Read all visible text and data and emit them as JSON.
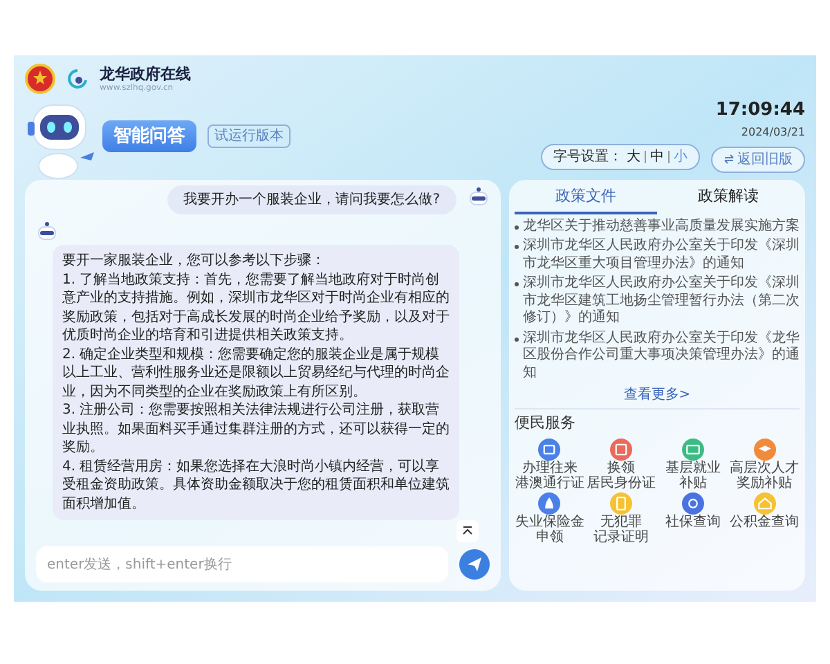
{
  "header": {
    "site_name": "龙华政府在线",
    "site_url": "www.szlhq.gov.cn",
    "badge": "智能问答",
    "tag": "试运行版本",
    "time": "17:09:44",
    "date": "2024/03/21",
    "font_size": {
      "label": "字号设置：",
      "options": [
        {
          "label": "大",
          "selected": false
        },
        {
          "label": "中",
          "selected": false
        },
        {
          "label": "小",
          "selected": true
        }
      ]
    },
    "back_button": "返回旧版"
  },
  "chat": {
    "messages": [
      {
        "kind": "user",
        "text": "我要开办一个服装企业，请问我要怎么做?"
      },
      {
        "kind": "bot",
        "paragraphs": [
          "要开一家服装企业，您可以参考以下步骤：",
          "1. 了解当地政策支持：首先，您需要了解当地政府对于时尚创意产业的支持措施。例如，深圳市龙华区对于时尚企业有相应的奖励政策，包括对于高成长发展的时尚企业给予奖励，以及对于优质时尚企业的培育和引进提供相关政策支持。",
          "2. 确定企业类型和规模：您需要确定您的服装企业是属于规模以上工业、营利性服务业还是限额以上贸易经纪与代理的时尚企业，因为不同类型的企业在奖励政策上有所区别。",
          "3. 注册公司：您需要按照相关法律法规进行公司注册，获取营业执照。如果面料买手通过集群注册的方式，还可以获得一定的奖励。",
          "4. 租赁经营用房：如果您选择在大浪时尚小镇内经营，可以享受租金资助政策。具体资助金额取决于您的租赁面积和单位建筑面积增加值。"
        ]
      }
    ],
    "input": {
      "placeholder": "enter发送，shift+enter换行"
    }
  },
  "policy": {
    "tabs": [
      {
        "label": "政策文件",
        "selected": true
      },
      {
        "label": "政策解读",
        "selected": false
      }
    ],
    "items": [
      "龙华区关于推动慈善事业高质量发展实施方案",
      "深圳市龙华区人民政府办公室关于印发《深圳市龙华区重大项目管理办法》的通知",
      "深圳市龙华区人民政府办公室关于印发《深圳市龙华区建筑工地扬尘管理暂行办法（第二次修订）》的通知",
      "深圳市龙华区人民政府办公室关于印发《龙华区股份合作公司重大事项决策管理办法》的通知"
    ],
    "more": "查看更多>"
  },
  "services": {
    "title": "便民服务",
    "items": [
      {
        "lines": [
          "办理往来",
          "港澳通行证"
        ],
        "color": "#4a80e8"
      },
      {
        "lines": [
          "换领",
          "居民身份证"
        ],
        "color": "#ea6a5c"
      },
      {
        "lines": [
          "基层就业",
          "补贴"
        ],
        "color": "#3dbb85"
      },
      {
        "lines": [
          "高层次人才",
          "奖励补贴"
        ],
        "color": "#f28a3c"
      },
      {
        "lines": [
          "失业保险金",
          "申领"
        ],
        "color": "#4a80e8"
      },
      {
        "lines": [
          "无犯罪",
          "记录证明"
        ],
        "color": "#f5c233"
      },
      {
        "lines": [
          "社保查询"
        ],
        "color": "#4a73e0"
      },
      {
        "lines": [
          "公积金查询"
        ],
        "color": "#f5c233"
      }
    ]
  }
}
